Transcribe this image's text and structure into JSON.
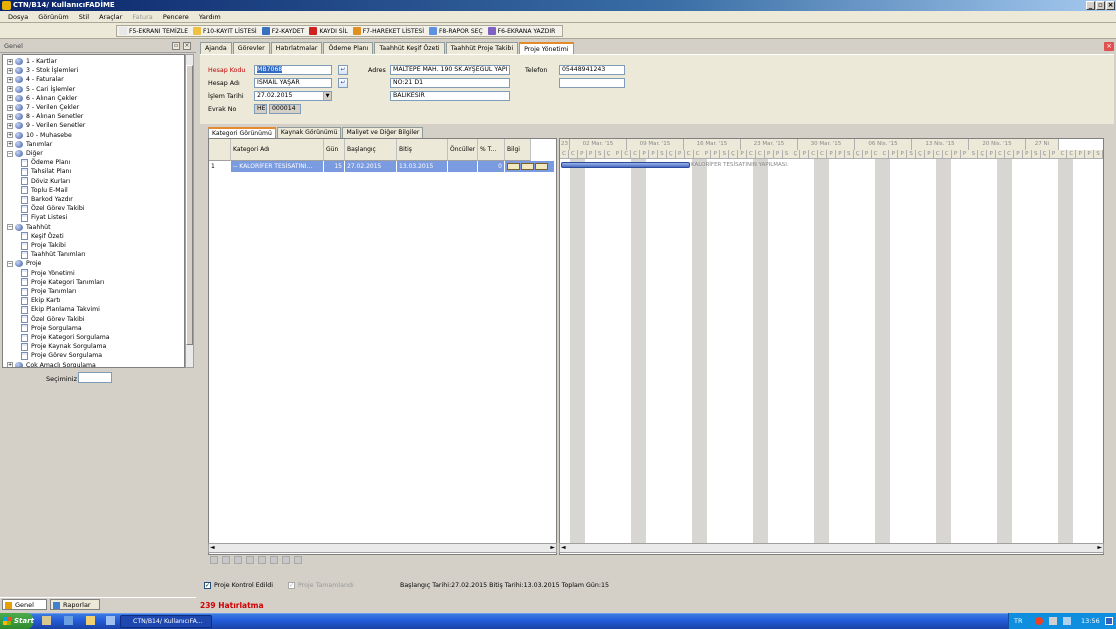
{
  "window": {
    "title": "CTN/B14/ KullanıcıFADİME"
  },
  "menu": [
    "Dosya",
    "Görünüm",
    "Stil",
    "Araçlar",
    "Fatura",
    "Pencere",
    "Yardım"
  ],
  "toolbar": {
    "buttons": [
      {
        "label": "F5-EKRANI TEMİZLE",
        "icon": "clear-icon",
        "color": "#e8e8e8"
      },
      {
        "label": "F10-KAYIT LİSTESİ",
        "icon": "list-icon",
        "color": "#f0c040"
      },
      {
        "label": "F2-KAYDET",
        "icon": "save-icon",
        "color": "#3a70c0"
      },
      {
        "label": "KAYDI SİL",
        "icon": "delete-icon",
        "color": "#d02020"
      },
      {
        "label": "F7-HAREKET LİSTESİ",
        "icon": "movement-list-icon",
        "color": "#e09020"
      },
      {
        "label": "F8-RAPOR SEÇ",
        "icon": "report-icon",
        "color": "#6090e0"
      },
      {
        "label": "F6-EKRANA YAZDIR",
        "icon": "print-icon",
        "color": "#8060c0"
      }
    ]
  },
  "left_panel": {
    "title": "Genel",
    "tree": [
      {
        "label": "1 - Kartlar",
        "type": "folder",
        "level": 0
      },
      {
        "label": "3 - Stok İşlemleri",
        "type": "folder",
        "level": 0
      },
      {
        "label": "4 - Faturalar",
        "type": "folder",
        "level": 0
      },
      {
        "label": "5 - Cari İşlemler",
        "type": "folder",
        "level": 0
      },
      {
        "label": "6 - Alınan Çekler",
        "type": "folder",
        "level": 0
      },
      {
        "label": "7 - Verilen Çekler",
        "type": "folder",
        "level": 0
      },
      {
        "label": "8 - Alınan Senetler",
        "type": "folder",
        "level": 0
      },
      {
        "label": "9 - Verilen Senetler",
        "type": "folder",
        "level": 0
      },
      {
        "label": "10 - Muhasebe",
        "type": "folder",
        "level": 0
      },
      {
        "label": "Tanımlar",
        "type": "folder",
        "level": 0
      },
      {
        "label": "Diğer",
        "type": "folder",
        "level": 0,
        "open": true
      },
      {
        "label": "Ödeme Planı",
        "type": "doc",
        "level": 1
      },
      {
        "label": "Tahsilat Planı",
        "type": "doc",
        "level": 1
      },
      {
        "label": "Döviz Kurları",
        "type": "doc",
        "level": 1
      },
      {
        "label": "Toplu E-Mail",
        "type": "doc",
        "level": 1
      },
      {
        "label": "Barkod Yazdır",
        "type": "doc",
        "level": 1
      },
      {
        "label": "Özel Görev Takibi",
        "type": "doc",
        "level": 1
      },
      {
        "label": "Fiyat Listesi",
        "type": "doc",
        "level": 1
      },
      {
        "label": "Taahhüt",
        "type": "folder",
        "level": 0,
        "open": true
      },
      {
        "label": "Keşif Özeti",
        "type": "doc",
        "level": 1
      },
      {
        "label": "Proje Takibi",
        "type": "doc",
        "level": 1
      },
      {
        "label": "Taahhüt Tanımları",
        "type": "doc",
        "level": 1
      },
      {
        "label": "Proje",
        "type": "folder",
        "level": 0,
        "open": true
      },
      {
        "label": "Proje Yönetimi",
        "type": "doc",
        "level": 1
      },
      {
        "label": "Proje Kategori Tanımları",
        "type": "doc",
        "level": 1
      },
      {
        "label": "Proje Tanımları",
        "type": "doc",
        "level": 1
      },
      {
        "label": "Ekip Kartı",
        "type": "doc",
        "level": 1
      },
      {
        "label": "Ekip Planlama Takvimi",
        "type": "doc",
        "level": 1
      },
      {
        "label": "Özel Görev Takibi",
        "type": "doc",
        "level": 1
      },
      {
        "label": "Proje Sorgulama",
        "type": "doc",
        "level": 1
      },
      {
        "label": "Proje Kategori Sorgulama",
        "type": "doc",
        "level": 1
      },
      {
        "label": "Proje Kaynak Sorgulama",
        "type": "doc",
        "level": 1
      },
      {
        "label": "Proje Görev Sorgulama",
        "type": "doc",
        "level": 1
      },
      {
        "label": "Çok Amaçlı Sorgulama",
        "type": "folder",
        "level": 0
      }
    ],
    "search_label": "Seçiminiz",
    "search_value": "",
    "bottom_tabs": [
      "Genel",
      "Raporlar"
    ]
  },
  "tabs": [
    "Ajanda",
    "Görevler",
    "Hatırlatmalar",
    "Ödeme Planı",
    "Taahhüt Keşif Özeti",
    "Taahhüt Proje Takibi",
    "Proje Yönetimi"
  ],
  "active_tab": "Proje Yönetimi",
  "form": {
    "hesap_kodu_label": "Hesap Kodu",
    "hesap_kodu": "MB7068",
    "hesap_adi_label": "Hesap Adı",
    "hesap_adi": "İSMAİL YAŞAR",
    "islem_tarihi_label": "İşlem Tarihi",
    "islem_tarihi": "27.02.2015",
    "evrak_no_label": "Evrak No",
    "evrak_seri": "HE",
    "evrak_no": "000014",
    "adres_label": "Adres",
    "adres1": "MALTEPE MAH. 190 SK.AYŞEGÜL YAPI",
    "adres2": "NO:21 D1",
    "adres3": "BALIKESİR",
    "telefon_label": "Telefon",
    "telefon1": "05448941243",
    "telefon2": ""
  },
  "subtabs": [
    "Kategori Görünümü",
    "Kaynak Görünümü",
    "Maliyet ve Diğer Bilgiler"
  ],
  "grid": {
    "columns": [
      "Kategori Adı",
      "Gün",
      "Başlangıç",
      "Bitiş",
      "Öncüller",
      "% T...",
      "Bilgi"
    ],
    "rows": [
      {
        "no": "1",
        "kategori": "-- KALORİFER TESİSATINI...",
        "gun": "15",
        "baslangic": "27.02.2015",
        "bitis": "13.03.2015",
        "onculler": "",
        "tamam": "0"
      }
    ]
  },
  "gantt": {
    "weeks": [
      "23 Ş",
      "02 Mar. '15",
      "09 Mar. '15",
      "16 Mar. '15",
      "23 Mar. '15",
      "30 Mar. '15",
      "06 Nis. '15",
      "13 Nis. '15",
      "20 Nis. '15",
      "27 Ni"
    ],
    "day_letters": [
      "C",
      "C",
      "P",
      "P",
      "S",
      "Ç",
      "P",
      "C",
      "C",
      "P",
      "P",
      "S",
      "Ç",
      "P",
      "C",
      "C",
      "P",
      "P",
      "S",
      "Ç",
      "P",
      "C",
      "C",
      "P",
      "P",
      "S",
      "Ç",
      "P",
      "C",
      "C",
      "P",
      "P",
      "S",
      "Ç",
      "P",
      "C",
      "C",
      "P",
      "P",
      "S",
      "Ç",
      "P",
      "C",
      "C",
      "P",
      "P",
      "S",
      "Ç",
      "P",
      "C",
      "C",
      "P",
      "P",
      "S",
      "Ç",
      "P",
      "C",
      "C",
      "P",
      "P",
      "S"
    ],
    "task_label": "KALORİFER TESİSATININ YAPILMASI."
  },
  "footer": {
    "proje_kontrol": "Proje Kontrol Edildi",
    "proje_tamamlandi": "Proje Tamamlandı",
    "summary": "Başlangıç Tarihi:27.02.2015 Bitiş Tarihi:13.03.2015 Toplam Gün:15",
    "hatirlatma": "239 Hatırlatma"
  },
  "taskbar": {
    "start": "Start",
    "task": "CTN/B14/ KullanıcıFA...",
    "lang": "TR",
    "time": "13:56"
  }
}
